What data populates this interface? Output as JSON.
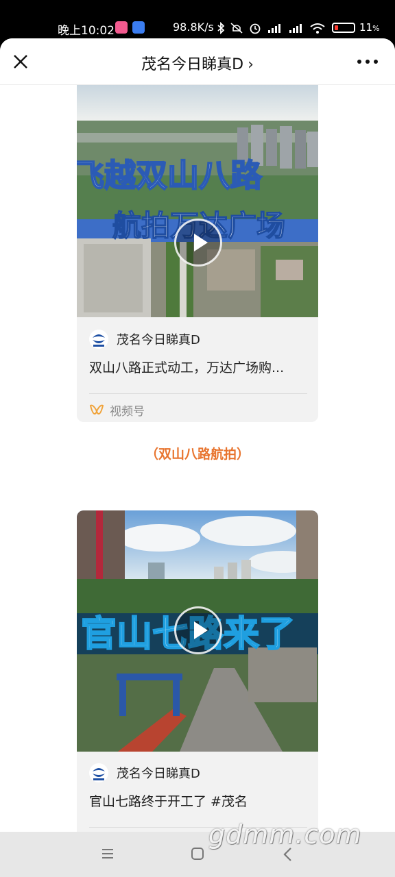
{
  "status_bar": {
    "time": "晚上10:02",
    "net_speed": "98.8K/s",
    "battery": "11",
    "battery_suffix": "%"
  },
  "header": {
    "title": "茂名今日睇真D",
    "title_chevron": "›"
  },
  "cards": [
    {
      "overlay_line1": "飞越双山八路",
      "overlay_line2": "航拍万达广场",
      "author": "茂名今日睇真D",
      "description": "双山八路正式动工，万达广场购...",
      "channel": "视频号"
    },
    {
      "overlay_line1": "官山七路来了",
      "author": "茂名今日睇真D",
      "description": "官山七路终于开工了 #茂名"
    }
  ],
  "caption": "（双山八路航拍）",
  "watermark": "gdmm.com",
  "colors": {
    "accent": "#e8742e",
    "card_bg": "#f2f2f2",
    "channel_icon": "#f0a33a"
  },
  "icons": {
    "close": "close-icon",
    "more": "more-icon",
    "play": "play-icon",
    "channel": "video-channel-icon"
  }
}
